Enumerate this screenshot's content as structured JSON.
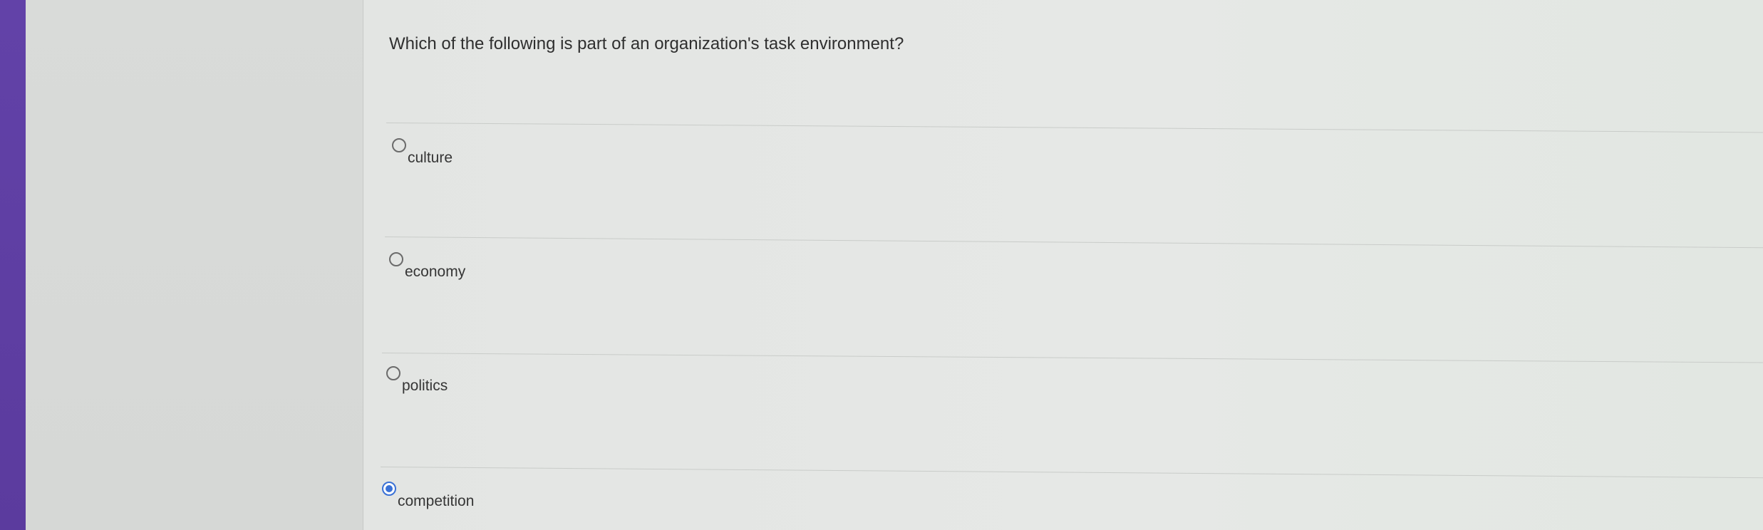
{
  "question": {
    "text": "Which of the following is part of an organization's task environment?"
  },
  "options": [
    {
      "label": "culture",
      "selected": false
    },
    {
      "label": "economy",
      "selected": false
    },
    {
      "label": "politics",
      "selected": false
    },
    {
      "label": "competition",
      "selected": true
    }
  ],
  "colors": {
    "accent_sidebar": "#5b3b9e",
    "radio_selected": "#3a71d6"
  }
}
